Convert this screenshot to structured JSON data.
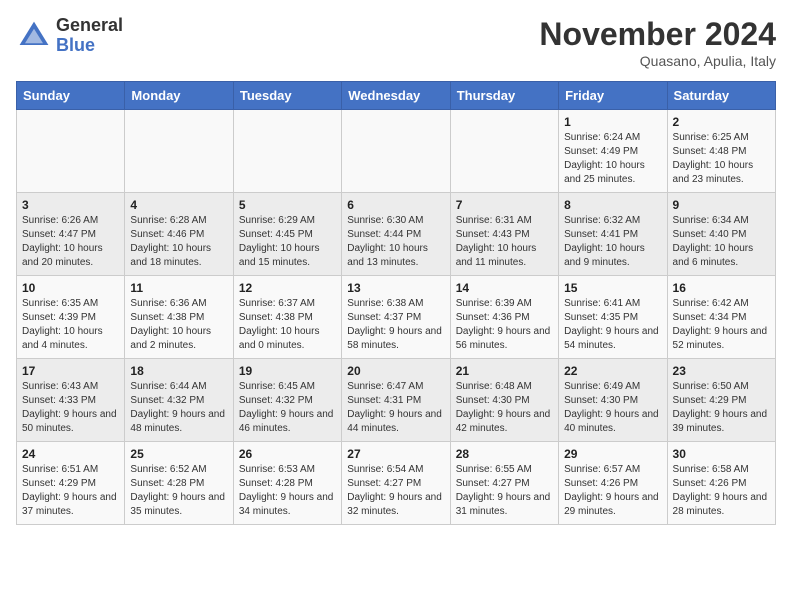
{
  "header": {
    "logo_general": "General",
    "logo_blue": "Blue",
    "main_title": "November 2024",
    "subtitle": "Quasano, Apulia, Italy"
  },
  "days_of_week": [
    "Sunday",
    "Monday",
    "Tuesday",
    "Wednesday",
    "Thursday",
    "Friday",
    "Saturday"
  ],
  "weeks": [
    [
      {
        "day": "",
        "info": ""
      },
      {
        "day": "",
        "info": ""
      },
      {
        "day": "",
        "info": ""
      },
      {
        "day": "",
        "info": ""
      },
      {
        "day": "",
        "info": ""
      },
      {
        "day": "1",
        "info": "Sunrise: 6:24 AM\nSunset: 4:49 PM\nDaylight: 10 hours and 25 minutes."
      },
      {
        "day": "2",
        "info": "Sunrise: 6:25 AM\nSunset: 4:48 PM\nDaylight: 10 hours and 23 minutes."
      }
    ],
    [
      {
        "day": "3",
        "info": "Sunrise: 6:26 AM\nSunset: 4:47 PM\nDaylight: 10 hours and 20 minutes."
      },
      {
        "day": "4",
        "info": "Sunrise: 6:28 AM\nSunset: 4:46 PM\nDaylight: 10 hours and 18 minutes."
      },
      {
        "day": "5",
        "info": "Sunrise: 6:29 AM\nSunset: 4:45 PM\nDaylight: 10 hours and 15 minutes."
      },
      {
        "day": "6",
        "info": "Sunrise: 6:30 AM\nSunset: 4:44 PM\nDaylight: 10 hours and 13 minutes."
      },
      {
        "day": "7",
        "info": "Sunrise: 6:31 AM\nSunset: 4:43 PM\nDaylight: 10 hours and 11 minutes."
      },
      {
        "day": "8",
        "info": "Sunrise: 6:32 AM\nSunset: 4:41 PM\nDaylight: 10 hours and 9 minutes."
      },
      {
        "day": "9",
        "info": "Sunrise: 6:34 AM\nSunset: 4:40 PM\nDaylight: 10 hours and 6 minutes."
      }
    ],
    [
      {
        "day": "10",
        "info": "Sunrise: 6:35 AM\nSunset: 4:39 PM\nDaylight: 10 hours and 4 minutes."
      },
      {
        "day": "11",
        "info": "Sunrise: 6:36 AM\nSunset: 4:38 PM\nDaylight: 10 hours and 2 minutes."
      },
      {
        "day": "12",
        "info": "Sunrise: 6:37 AM\nSunset: 4:38 PM\nDaylight: 10 hours and 0 minutes."
      },
      {
        "day": "13",
        "info": "Sunrise: 6:38 AM\nSunset: 4:37 PM\nDaylight: 9 hours and 58 minutes."
      },
      {
        "day": "14",
        "info": "Sunrise: 6:39 AM\nSunset: 4:36 PM\nDaylight: 9 hours and 56 minutes."
      },
      {
        "day": "15",
        "info": "Sunrise: 6:41 AM\nSunset: 4:35 PM\nDaylight: 9 hours and 54 minutes."
      },
      {
        "day": "16",
        "info": "Sunrise: 6:42 AM\nSunset: 4:34 PM\nDaylight: 9 hours and 52 minutes."
      }
    ],
    [
      {
        "day": "17",
        "info": "Sunrise: 6:43 AM\nSunset: 4:33 PM\nDaylight: 9 hours and 50 minutes."
      },
      {
        "day": "18",
        "info": "Sunrise: 6:44 AM\nSunset: 4:32 PM\nDaylight: 9 hours and 48 minutes."
      },
      {
        "day": "19",
        "info": "Sunrise: 6:45 AM\nSunset: 4:32 PM\nDaylight: 9 hours and 46 minutes."
      },
      {
        "day": "20",
        "info": "Sunrise: 6:47 AM\nSunset: 4:31 PM\nDaylight: 9 hours and 44 minutes."
      },
      {
        "day": "21",
        "info": "Sunrise: 6:48 AM\nSunset: 4:30 PM\nDaylight: 9 hours and 42 minutes."
      },
      {
        "day": "22",
        "info": "Sunrise: 6:49 AM\nSunset: 4:30 PM\nDaylight: 9 hours and 40 minutes."
      },
      {
        "day": "23",
        "info": "Sunrise: 6:50 AM\nSunset: 4:29 PM\nDaylight: 9 hours and 39 minutes."
      }
    ],
    [
      {
        "day": "24",
        "info": "Sunrise: 6:51 AM\nSunset: 4:29 PM\nDaylight: 9 hours and 37 minutes."
      },
      {
        "day": "25",
        "info": "Sunrise: 6:52 AM\nSunset: 4:28 PM\nDaylight: 9 hours and 35 minutes."
      },
      {
        "day": "26",
        "info": "Sunrise: 6:53 AM\nSunset: 4:28 PM\nDaylight: 9 hours and 34 minutes."
      },
      {
        "day": "27",
        "info": "Sunrise: 6:54 AM\nSunset: 4:27 PM\nDaylight: 9 hours and 32 minutes."
      },
      {
        "day": "28",
        "info": "Sunrise: 6:55 AM\nSunset: 4:27 PM\nDaylight: 9 hours and 31 minutes."
      },
      {
        "day": "29",
        "info": "Sunrise: 6:57 AM\nSunset: 4:26 PM\nDaylight: 9 hours and 29 minutes."
      },
      {
        "day": "30",
        "info": "Sunrise: 6:58 AM\nSunset: 4:26 PM\nDaylight: 9 hours and 28 minutes."
      }
    ]
  ]
}
